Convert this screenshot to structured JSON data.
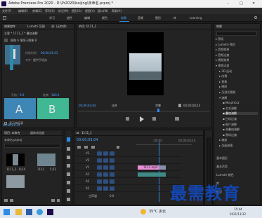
{
  "window": {
    "title": "Adobe Premiere Pro 2020 - D:\\Pr2020\\beijing\\未命名.prproj *",
    "controls": [
      "–",
      "□",
      "✕"
    ]
  },
  "menu": [
    "文件(F)",
    "编辑(E)",
    "剪辑(C)",
    "序列(S)",
    "标记(M)",
    "图形(G)",
    "视图(V)",
    "窗口(W)",
    "帮助(H)"
  ],
  "workspace_tabs": [
    "学习",
    "组件",
    "编辑",
    "颜色",
    "效果",
    "音频",
    "图形",
    "库",
    "Learning"
  ],
  "active_workspace": "效果",
  "effect_controls": {
    "tabs": [
      "效果控件",
      "Lumetri 范围",
      "源: (无剪辑)",
      "音频"
    ],
    "clip": "主要 * 1111_1 * 叠加溶解",
    "transition_desc": "图像 A 渐隐于图像 B",
    "duration_label": "持续时间",
    "duration": "00;00;01;03",
    "align_label": "对齐：",
    "align_value": "居中于切点",
    "start_label": "开始：",
    "start_value": "0.0",
    "end_label": "结束：",
    "end_value": "100.0",
    "a_label": "A",
    "b_label": "B",
    "show_actual": "显示实际源",
    "timecode": "00;00;01;24"
  },
  "program": {
    "title": "节目: 1111_1",
    "timecode": "00;00;03;04",
    "fit": "适合",
    "quality": "完整",
    "duration": "00;00;08;14"
  },
  "project": {
    "tabs": [
      "项目: 未命名",
      "媒体浏览器"
    ],
    "file": "未命名.prproj",
    "items": [
      {
        "name": "1111_1",
        "duration": "8;14"
      },
      {
        "name": "1111",
        "duration": "5;22"
      }
    ]
  },
  "timeline": {
    "sequence": "1111_1",
    "timecode": "00;00;03;04",
    "ruler": [
      ";00;00",
      "00;00;04;14"
    ],
    "video_tracks": [
      "V3",
      "V2",
      "V1"
    ],
    "audio_tracks": [
      "A1",
      "A2",
      "A3"
    ],
    "master": "主声道",
    "master_value": "0.0",
    "clip_v1": "1111.mp4",
    "clip_v1b": "1111.mp4",
    "levels": [
      "0",
      "-12",
      "-24",
      "-36",
      "-48",
      "dB"
    ]
  },
  "effects": {
    "title": "效果",
    "tabs": [
      "效果",
      "基本图形",
      "基本声音",
      "Lumetri 颜色",
      "库",
      "标记",
      "历史记录"
    ],
    "tree": [
      {
        "label": "预设",
        "level": 0,
        "open": false
      },
      {
        "label": "Lumetri 预设",
        "level": 0,
        "open": false
      },
      {
        "label": "音频效果",
        "level": 0,
        "open": false
      },
      {
        "label": "音频过渡",
        "level": 0,
        "open": false
      },
      {
        "label": "视频效果",
        "level": 0,
        "open": false
      },
      {
        "label": "视频过渡",
        "level": 0,
        "open": true
      },
      {
        "label": "3D 运动",
        "level": 1,
        "open": false
      },
      {
        "label": "内滑",
        "level": 1,
        "open": false
      },
      {
        "label": "划像",
        "level": 1,
        "open": false
      },
      {
        "label": "擦除",
        "level": 1,
        "open": false
      },
      {
        "label": "沉浸式视频",
        "level": 1,
        "open": false
      },
      {
        "label": "溶解",
        "level": 1,
        "open": true
      },
      {
        "label": "MorphCut",
        "level": 2,
        "open": false
      },
      {
        "label": "交叉溶解",
        "level": 2,
        "open": false
      },
      {
        "label": "叠加溶解",
        "level": 2,
        "open": false,
        "selected": true
      },
      {
        "label": "白场过渡",
        "level": 2,
        "open": false
      },
      {
        "label": "胶片溶解",
        "level": 2,
        "open": false
      },
      {
        "label": "非叠加溶解",
        "level": 2,
        "open": false
      },
      {
        "label": "黑场过渡",
        "level": 2,
        "open": false
      },
      {
        "label": "缩放",
        "level": 1,
        "open": false
      },
      {
        "label": "页面剥落",
        "level": 1,
        "open": false
      }
    ],
    "bottom_panels": [
      "基本图形",
      "基本声音",
      "Lumetri 颜色",
      "库",
      "标记"
    ]
  },
  "watermark": "最需教育",
  "taskbar": {
    "weather": "35°C 多云",
    "time": "15:44",
    "date": "2021/11/12"
  },
  "colors": {
    "accent": "#2d8ceb",
    "clip_a": "#3e86b6",
    "clip_b": "#3fb893",
    "pink_clip": "#e68fd6",
    "watermark": "#1346b2"
  }
}
